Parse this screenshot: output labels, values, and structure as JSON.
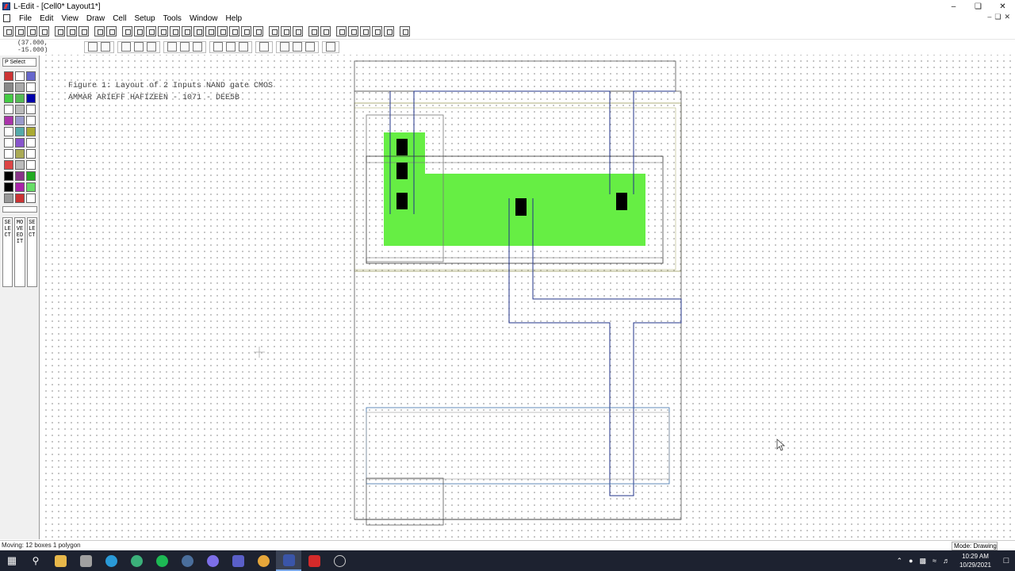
{
  "window": {
    "title": "L-Edit - [Cell0*     Layout1*]",
    "controls": [
      "minimize",
      "restore",
      "close"
    ]
  },
  "menu": {
    "items": [
      "File",
      "Edit",
      "View",
      "Draw",
      "Cell",
      "Setup",
      "Tools",
      "Window",
      "Help"
    ]
  },
  "toolbar": {
    "coordinates": "(37.000, -15.000)"
  },
  "palette": {
    "layer_select": "P Select",
    "swatch_colors": [
      "#cc3333",
      "#ffffff",
      "#6666cc",
      "#888888",
      "#aaaaaa",
      "#ffffff",
      "#44cc44",
      "#55bb55",
      "#0000aa",
      "#ffffff",
      "#bbbbbb",
      "#ffffff",
      "#aa33aa",
      "#9999cc",
      "#ffffff",
      "#ffffff",
      "#55aaaa",
      "#aaaa33",
      "#ffffff",
      "#8855cc",
      "#ffffff",
      "#ffffff",
      "#aaaa55",
      "#ffffff",
      "#dd4444",
      "#bbbbbb",
      "#ffffff",
      "#000000",
      "#883388",
      "#22aa22",
      "#000000",
      "#aa22aa",
      "#66dd66",
      "#999999",
      "#cc3333",
      "#ffffff"
    ],
    "mode_columns": [
      "SELECT",
      "MOVE EDIT",
      "SELECT"
    ]
  },
  "canvas": {
    "caption_line1": "Figure 1: Layout of 2 Inputs NAND gate CMOS",
    "caption_line2": "AMMAR ARIEFF HAFIZEEN - 1071 - DEE5B",
    "active_area_color": "#66ee44",
    "contact_color": "#000000",
    "metal_color": "#22338a",
    "poly_color": "#3a6fa8",
    "well_color": "#9a9a5a"
  },
  "status": {
    "left": "Moving: 12 boxes 1 polygon",
    "mode": "Mode: Drawing"
  },
  "taskbar": {
    "time": "10:29 AM",
    "date": "10/29/2021",
    "apps": [
      "file-explorer",
      "files",
      "edge",
      "spotify",
      "steam",
      "discord",
      "teams",
      "chrome",
      "l-edit",
      "acrobat",
      "clock"
    ]
  }
}
